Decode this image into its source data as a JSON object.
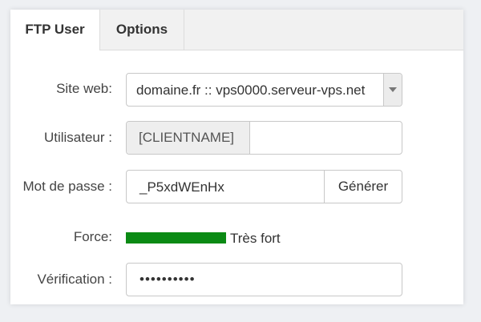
{
  "tabs": [
    {
      "label": "FTP User",
      "active": true
    },
    {
      "label": "Options",
      "active": false
    }
  ],
  "form": {
    "site": {
      "label": "Site web:",
      "value": "domaine.fr :: vps0000.serveur-vps.net"
    },
    "user": {
      "label": "Utilisateur :",
      "prefix": "[CLIENTNAME]",
      "value": ""
    },
    "password": {
      "label": "Mot de passe :",
      "value": "_P5xdWEnHx",
      "generate_label": "Générer"
    },
    "strength": {
      "label": "Force:",
      "text": "Très fort",
      "level": 1.0,
      "color": "#0b8a14"
    },
    "verification": {
      "label": "Vérification :",
      "value": "••••••••••"
    }
  }
}
